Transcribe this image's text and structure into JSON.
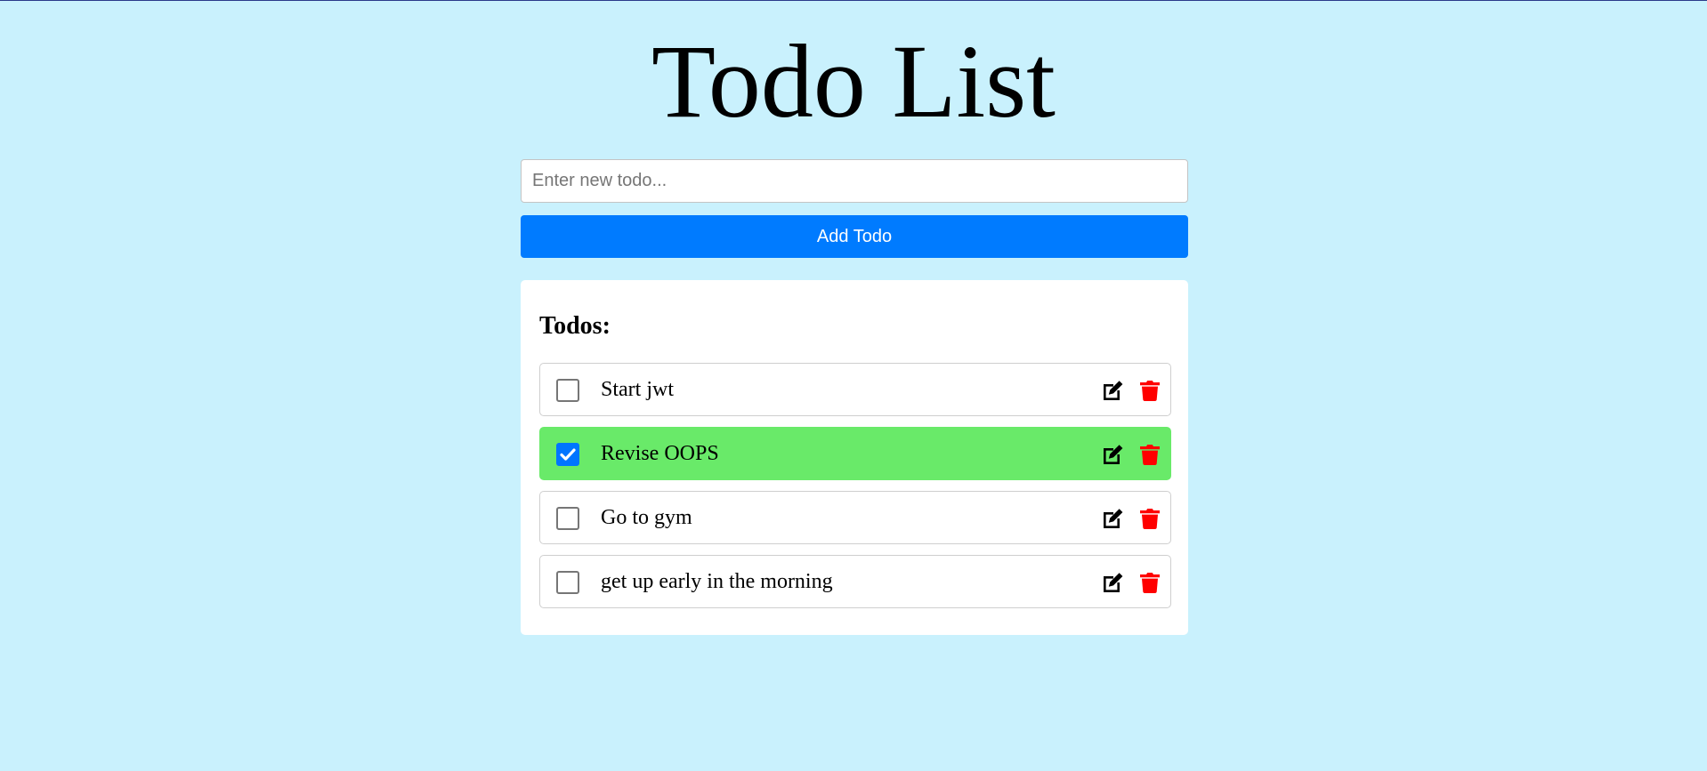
{
  "header": {
    "title": "Todo List"
  },
  "form": {
    "input_placeholder": "Enter new todo...",
    "input_value": "",
    "add_label": "Add Todo"
  },
  "list": {
    "heading": "Todos:",
    "items": [
      {
        "text": "Start jwt",
        "completed": false
      },
      {
        "text": "Revise OOPS",
        "completed": true
      },
      {
        "text": "Go to gym",
        "completed": false
      },
      {
        "text": "get up early in the morning",
        "completed": false
      }
    ]
  },
  "icons": {
    "edit": "edit-icon",
    "delete": "trash-icon",
    "check": "checkmark-icon"
  },
  "colors": {
    "background": "#c9f1fd",
    "primary": "#007bff",
    "completed": "#69ea69",
    "delete": "#ff0000"
  }
}
